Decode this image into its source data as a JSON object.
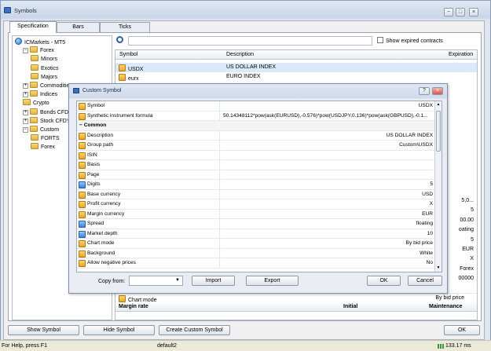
{
  "window": {
    "title": "Symbols"
  },
  "tabs": [
    {
      "label": "Specification"
    },
    {
      "label": "Bars"
    },
    {
      "label": "Ticks"
    }
  ],
  "tree": [
    {
      "label": "ICMarkets - MT5",
      "level": 0,
      "icon": "server"
    },
    {
      "label": "Forex",
      "level": 1,
      "icon": "folder",
      "expander": "−"
    },
    {
      "label": "Minors",
      "level": 2,
      "icon": "folder"
    },
    {
      "label": "Exotics",
      "level": 2,
      "icon": "folder"
    },
    {
      "label": "Majors",
      "level": 2,
      "icon": "folder"
    },
    {
      "label": "Commodities",
      "level": 1,
      "icon": "folder",
      "expander": "+"
    },
    {
      "label": "Indices",
      "level": 1,
      "icon": "folder",
      "expander": "+"
    },
    {
      "label": "Crypto",
      "level": 1,
      "icon": "folder"
    },
    {
      "label": "Bonds CFDs",
      "level": 1,
      "icon": "folder",
      "expander": "+"
    },
    {
      "label": "Stock CFD's",
      "level": 1,
      "icon": "folder",
      "expander": "+"
    },
    {
      "label": "Custom",
      "level": 1,
      "icon": "folder",
      "expander": "−"
    },
    {
      "label": "FORTS",
      "level": 2,
      "icon": "folder"
    },
    {
      "label": "Forex",
      "level": 2,
      "icon": "folder"
    }
  ],
  "search": {
    "placeholder": ""
  },
  "show_expired": {
    "label": "Show expired contracts"
  },
  "symbols_table": {
    "headers": {
      "symbol": "Symbol",
      "description": "Description",
      "expiration": "Expiration"
    },
    "rows": [
      {
        "symbol": "USDX",
        "description": "US DOLLAR INDEX"
      },
      {
        "symbol": "eurx",
        "description": "EURO INDEX"
      }
    ]
  },
  "right_values": [
    "5,0...",
    "5",
    "00.00",
    "oating",
    "5",
    "EUR",
    "X",
    "Forex",
    "00000"
  ],
  "bg_chart_mode": {
    "label": "Chart mode",
    "value": "By bid price"
  },
  "margin_header": {
    "rate": "Margin rate",
    "initial": "Initial",
    "maintenance": "Maintenance"
  },
  "bottom_buttons": {
    "show": "Show Symbol",
    "hide": "Hide Symbol",
    "create": "Create Custom Symbol",
    "ok": "OK"
  },
  "status": {
    "help": "For Help, press F1",
    "profile": "default2",
    "ping": "133.17 ms"
  },
  "dialog": {
    "title": "Custom Symbol",
    "help_label": "?",
    "rows": [
      {
        "label": "Symbol",
        "value": "USDX",
        "icon": "sym"
      },
      {
        "label": "Synthetic instrument formula",
        "value": "50.14348112*pow(ask(EURUSD),-0.576)*pow(USDJPY,0.136)*pow(ask(GBPUSD),-0.1...",
        "icon": "sym"
      },
      {
        "label": "Common",
        "value": "",
        "section": true
      },
      {
        "label": "Description",
        "value": "US DOLLAR INDEX",
        "icon": "sym"
      },
      {
        "label": "Group path",
        "value": "Custom\\USDX",
        "icon": "sym"
      },
      {
        "label": "ISIN",
        "value": "",
        "icon": "sym"
      },
      {
        "label": "Basis",
        "value": "",
        "icon": "sym"
      },
      {
        "label": "Page",
        "value": "",
        "icon": "sym"
      },
      {
        "label": "Digits",
        "value": "5",
        "icon": "num"
      },
      {
        "label": "Base currency",
        "value": "USD",
        "icon": "sym"
      },
      {
        "label": "Profit currency",
        "value": "X",
        "icon": "sym"
      },
      {
        "label": "Margin currency",
        "value": "EUR",
        "icon": "sym"
      },
      {
        "label": "Spread",
        "value": "floating",
        "icon": "num"
      },
      {
        "label": "Market depth",
        "value": "10",
        "icon": "num"
      },
      {
        "label": "Chart mode",
        "value": "By bid price",
        "icon": "sym"
      },
      {
        "label": "Background",
        "value": "White",
        "icon": "sym"
      },
      {
        "label": "Allow negative prices",
        "value": "No",
        "icon": "sym"
      }
    ],
    "copy_from_label": "Copy from:",
    "copy_from_value": "",
    "import_label": "Import",
    "export_label": "Export",
    "ok_label": "OK",
    "cancel_label": "Cancel"
  }
}
